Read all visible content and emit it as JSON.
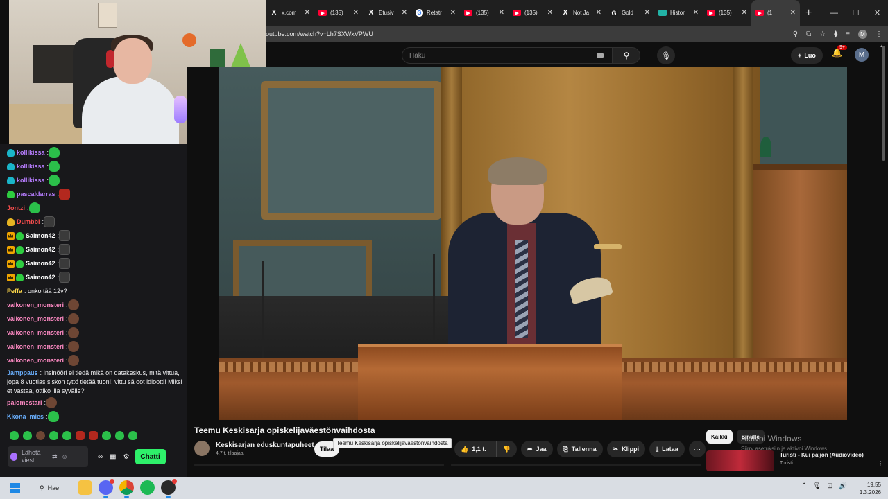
{
  "browser": {
    "tabs": [
      {
        "icon": "x-icon",
        "label": "x.com",
        "active": false
      },
      {
        "icon": "youtube-icon",
        "label": "(135)",
        "active": false
      },
      {
        "icon": "x-icon",
        "label": "Etusiv",
        "active": false
      },
      {
        "icon": "google-icon",
        "label": "Retatr",
        "active": false
      },
      {
        "icon": "youtube-icon",
        "label": "(135)",
        "active": false
      },
      {
        "icon": "youtube-icon",
        "label": "(135)",
        "active": false
      },
      {
        "icon": "x-icon",
        "label": "Not Ja",
        "active": false
      },
      {
        "icon": "gold-icon",
        "label": "Gold",
        "active": false
      },
      {
        "icon": "history-icon",
        "label": "Histor",
        "active": false
      },
      {
        "icon": "youtube-icon",
        "label": "(135)",
        "active": false
      },
      {
        "icon": "youtube-icon",
        "label": "(1",
        "active": true
      }
    ],
    "url": "outube.com/watch?v=Lh7SXWxVPWU",
    "profile_initial": "M"
  },
  "youtube": {
    "search_placeholder": "Haku",
    "create_label": "Luo",
    "notification_badge": "9+",
    "avatar_initial": "M",
    "video_title": "Teemu Keskisarja opiskelijaväestönvaihdosta",
    "channel_name": "Keskisarjan eduskuntapuheet",
    "subscribers": "4,7 t. tilaajaa",
    "subscribe_label": "Tilaa",
    "tooltip": "Teemu Keskisarja opiskelijaväestönvaihdosta",
    "likes": "1,1 t.",
    "share_label": "Jaa",
    "save_label": "Tallenna",
    "clip_label": "Klippi",
    "download_label": "Lataa",
    "chips": [
      "Kaikki",
      "Sinulle"
    ],
    "activate_windows_title": "Aktivoi Windows",
    "activate_windows_sub": "Siirry asetuksiin ja aktivoi Windows.",
    "recommended": {
      "title": "Turisti - Kui paljon (Audiovideo)",
      "channel": "Turisti"
    }
  },
  "chat": {
    "messages": [
      {
        "badges": [
          "sub"
        ],
        "user": "kollikissa",
        "color": "#b77dff",
        "text": "",
        "emotes": [
          "pepe"
        ]
      },
      {
        "badges": [
          "sub"
        ],
        "user": "kollikissa",
        "color": "#b77dff",
        "text": "",
        "emotes": [
          "pepe"
        ]
      },
      {
        "badges": [
          "sub"
        ],
        "user": "kollikissa",
        "color": "#b77dff",
        "text": "",
        "emotes": [
          "pepe"
        ]
      },
      {
        "badges": [
          "sub-green"
        ],
        "user": "pascaldarras",
        "color": "#b77dff",
        "text": "",
        "emotes": [
          "devil"
        ]
      },
      {
        "badges": [],
        "user": "Jontzi",
        "color": "#ff4f4f",
        "text": "",
        "emotes": [
          "pepe"
        ]
      },
      {
        "badges": [
          "sub-gold"
        ],
        "user": "Dumbbi",
        "color": "#ff4f4f",
        "text": "",
        "emotes": [
          "dark"
        ]
      },
      {
        "badges": [
          "crown",
          "sub-green"
        ],
        "user": "Saimon42",
        "color": "#ffffff",
        "text": "",
        "emotes": [
          "dark"
        ]
      },
      {
        "badges": [
          "crown",
          "sub-green"
        ],
        "user": "Saimon42",
        "color": "#ffffff",
        "text": "",
        "emotes": [
          "dark"
        ]
      },
      {
        "badges": [
          "crown",
          "sub-green"
        ],
        "user": "Saimon42",
        "color": "#ffffff",
        "text": "",
        "emotes": [
          "dark"
        ]
      },
      {
        "badges": [
          "crown",
          "sub-green"
        ],
        "user": "Saimon42",
        "color": "#ffffff",
        "text": "",
        "emotes": [
          "dark"
        ]
      },
      {
        "badges": [],
        "user": "Peffa",
        "color": "#ffd94a",
        "text": "onko tää 12v?",
        "emotes": []
      },
      {
        "badges": [],
        "user": "valkonen_monsteri",
        "color": "#ff8ac4",
        "text": "",
        "emotes": [
          "monkey"
        ]
      },
      {
        "badges": [],
        "user": "valkonen_monsteri",
        "color": "#ff8ac4",
        "text": "",
        "emotes": [
          "monkey"
        ]
      },
      {
        "badges": [],
        "user": "valkonen_monsteri",
        "color": "#ff8ac4",
        "text": "",
        "emotes": [
          "monkey"
        ]
      },
      {
        "badges": [],
        "user": "valkonen_monsteri",
        "color": "#ff8ac4",
        "text": "",
        "emotes": [
          "monkey"
        ]
      },
      {
        "badges": [],
        "user": "valkonen_monsteri",
        "color": "#ff8ac4",
        "text": "",
        "emotes": [
          "monkey"
        ]
      },
      {
        "badges": [],
        "user": "Jamppaus",
        "color": "#6ab0ff",
        "text": "Insinööri ei tiedä mikä on datakeskus, mitä vittua, jopa 8 vuotias siskon tyttö tietää tuon!! vittu sä oot idiootti! Miksi et vastaa, ottiko liia syvälle?",
        "emotes": []
      },
      {
        "badges": [],
        "user": "palomestari",
        "color": "#ff8ac4",
        "text": "",
        "emotes": [
          "monkey"
        ]
      },
      {
        "badges": [],
        "user": "Kkona_mies",
        "color": "#6ab0ff",
        "text": "",
        "emotes": [
          "pepe"
        ]
      }
    ],
    "input_placeholder": "Lähetä viesti",
    "chat_button": "Chatti"
  },
  "taskbar": {
    "search_label": "Hae",
    "time": "19.55",
    "date": "1.3.2026"
  }
}
